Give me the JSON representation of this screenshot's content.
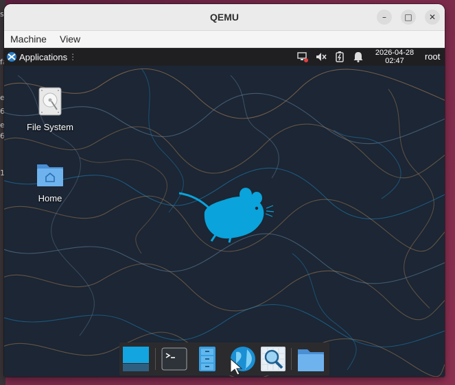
{
  "host": {
    "edge_fragments": [
      "st",
      "fa",
      "er",
      "6",
      "er",
      "6",
      "1"
    ]
  },
  "window": {
    "title": "QEMU",
    "controls": {
      "minimize": "–",
      "maximize": "□",
      "close": "✕"
    },
    "menu": [
      "Machine",
      "View"
    ]
  },
  "desktop": {
    "panel": {
      "applications_label": "Applications",
      "separator": "⋮",
      "clock_date": "2026-04-28",
      "clock_time": "02:47",
      "user": "root"
    },
    "icons": [
      {
        "label": "File System",
        "icon": "drive-harddisk-icon"
      },
      {
        "label": "Home",
        "icon": "home-folder-icon"
      }
    ],
    "dock": [
      {
        "name": "show-desktop",
        "icon": "show-desktop-icon"
      },
      {
        "name": "terminal",
        "icon": "terminal-icon"
      },
      {
        "name": "file-manager",
        "icon": "file-cabinet-icon"
      },
      {
        "name": "web-browser",
        "icon": "globe-icon"
      },
      {
        "name": "app-finder",
        "icon": "magnifier-icon"
      },
      {
        "name": "folder",
        "icon": "folder-icon"
      }
    ],
    "colors": {
      "panel_bg": "#1f1f22",
      "wallpaper_bg": "#1c2634",
      "mouse_logo": "#0aa3db",
      "folder_blue": "#5aa7e6"
    }
  }
}
